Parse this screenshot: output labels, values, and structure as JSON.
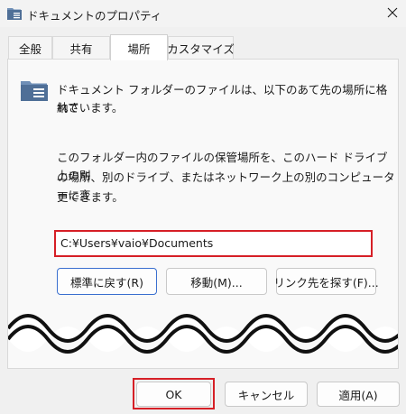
{
  "window": {
    "title": "ドキュメントのプロパティ"
  },
  "tabs": [
    {
      "label": "全般",
      "active": false
    },
    {
      "label": "共有",
      "active": false
    },
    {
      "label": "場所",
      "active": true
    },
    {
      "label": "カスタマイズ",
      "active": false
    }
  ],
  "location": {
    "intro_line1": "ドキュメント フォルダーのファイルは、以下のあて先の場所に格納さ",
    "intro_line2": "れています。",
    "desc_line1": "このフォルダー内のファイルの保管場所を、このハード ドライブ上の別",
    "desc_line2": "の場所、別のドライブ、またはネットワーク上の別のコンピューターに変",
    "desc_line3": "更できます。",
    "path": "C:¥Users¥vaio¥Documents",
    "restore_label": "標準に戻す(R)",
    "move_label": "移動(M)...",
    "find_target_label": "リンク先を探す(F)..."
  },
  "footer": {
    "ok_label": "OK",
    "cancel_label": "キャンセル",
    "apply_label": "適用(A)"
  },
  "colors": {
    "highlight": "#d61f26",
    "accent": "#3a6fcf",
    "folder_icon": "#4f6f97"
  },
  "icons": [
    "documents-folder-icon",
    "close-icon"
  ]
}
